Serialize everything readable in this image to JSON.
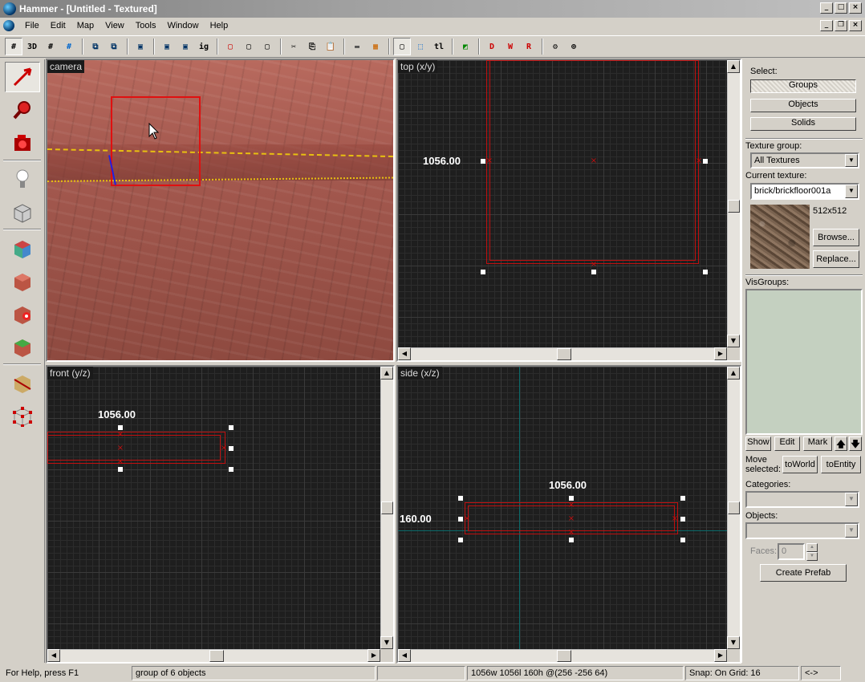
{
  "window": {
    "title": "Hammer - [Untitled - Textured]"
  },
  "menu": [
    "File",
    "Edit",
    "Map",
    "View",
    "Tools",
    "Window",
    "Help"
  ],
  "toolbar": {
    "grid_3d_label": "3D",
    "ignore_label": "ig",
    "tl_label": "tl"
  },
  "viewports": {
    "camera": {
      "label": "camera"
    },
    "top": {
      "label": "top (x/y)",
      "dim_width": "1056.00"
    },
    "front": {
      "label": "front (y/z)",
      "dim_width": "1056.00"
    },
    "side": {
      "label": "side (x/z)",
      "dim_width": "1056.00",
      "dim_height": "160.00"
    }
  },
  "panel": {
    "select_label": "Select:",
    "groups": "Groups",
    "objects": "Objects",
    "solids": "Solids",
    "texture_group_label": "Texture group:",
    "texture_group_value": "All Textures",
    "current_texture_label": "Current texture:",
    "current_texture_value": "brick/brickfloor001a",
    "texture_size": "512x512",
    "browse": "Browse...",
    "replace": "Replace...",
    "visgroups_label": "VisGroups:",
    "show": "Show",
    "edit": "Edit",
    "mark": "Mark",
    "move_selected_label": "Move\nselected:",
    "to_world": "toWorld",
    "to_entity": "toEntity",
    "categories_label": "Categories:",
    "objects_label": "Objects:",
    "faces_label": "Faces:",
    "faces_value": "0",
    "create_prefab": "Create Prefab"
  },
  "status": {
    "help": "For Help, press F1",
    "selection": "group of 6 objects",
    "empty": "",
    "dimensions": "1056w 1056l 160h @(256 -256 64)",
    "snap": "Snap: On Grid: 16",
    "extra": "<->"
  },
  "colors": {
    "selection": "#c01010",
    "grid_bg": "#1e1e1e",
    "panel_bg": "#d4d0c8",
    "visgroup_bg": "#c4d0c0"
  }
}
